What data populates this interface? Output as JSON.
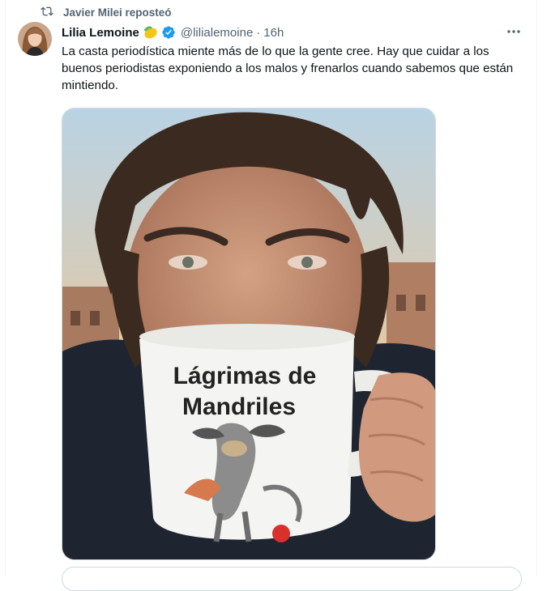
{
  "repost": {
    "label": "Javier Milei reposteó"
  },
  "tweet": {
    "author_name": "Lilia Lemoine",
    "author_emoji": "lemon-icon",
    "verified": true,
    "handle": "@lilialemoine",
    "separator": "·",
    "time": "16h",
    "text": "La casta periodística miente más de lo que la gente cree. Hay que cuidar a los buenos periodistas exponiendo a los malos y frenarlos cuando sabemos que están mintiendo."
  },
  "media": {
    "mug_text_line1": "Lágrimas de",
    "mug_text_line2": "Mandriles"
  },
  "colors": {
    "verified_blue": "#1d9bf0",
    "secondary_text": "#536471",
    "border": "#cfd9de"
  }
}
